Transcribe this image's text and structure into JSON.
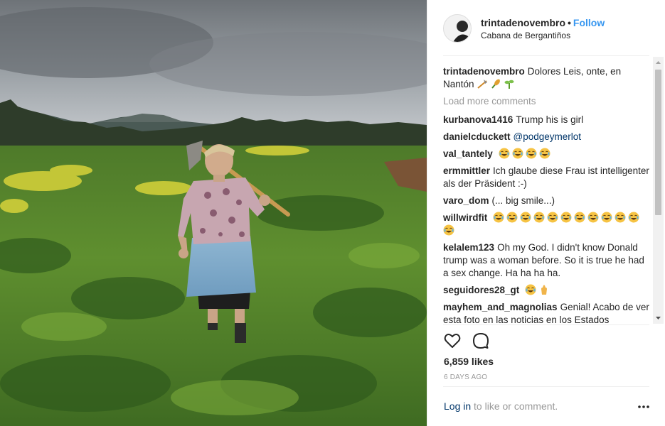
{
  "post": {
    "username": "trintadenovembro",
    "separator": "•",
    "follow_label": "Follow",
    "location": "Cabana de Bergantiños"
  },
  "caption": {
    "username": "trintadenovembro",
    "text": "Dolores Leis, onte, en Nantón"
  },
  "load_more_label": "Load more comments",
  "comments": [
    {
      "user": "kurbanova1416",
      "text": "Trump his is girl"
    },
    {
      "user": "danielcduckett",
      "text": "@podgeymerlot"
    },
    {
      "user": "val_tantely",
      "text": ""
    },
    {
      "user": "ermmittler",
      "text": "Ich glaube diese Frau ist intelligenter als der Präsident :-)"
    },
    {
      "user": "varo_dom",
      "text": "(... big smile...)"
    },
    {
      "user": "willwirdfit",
      "text": ""
    },
    {
      "user": "kelalem123",
      "text": "Oh my God. I didn't know Donald trump was a woman before. So it is true he had a sex change. Ha ha ha ha."
    },
    {
      "user": "seguidores28_gt",
      "text": ""
    },
    {
      "user": "mayhem_and_magnolias",
      "text": "Genial! Acabo de ver esta foto en las noticias en los Estados"
    }
  ],
  "likes": "6,859 likes",
  "time_ago": "6 DAYS AGO",
  "login": {
    "link": "Log in",
    "rest": "to like or comment."
  },
  "icons": {
    "like": "heart-icon",
    "comment": "comment-icon",
    "more": "more-options-icon",
    "emoji_laugh": "laughing-emoji-icon",
    "emoji_hands": "hands-emoji-icon"
  },
  "colors": {
    "link_blue": "#3897f0",
    "mention": "#003569",
    "muted": "#999999",
    "emoji_yellow": "#f6c343"
  }
}
